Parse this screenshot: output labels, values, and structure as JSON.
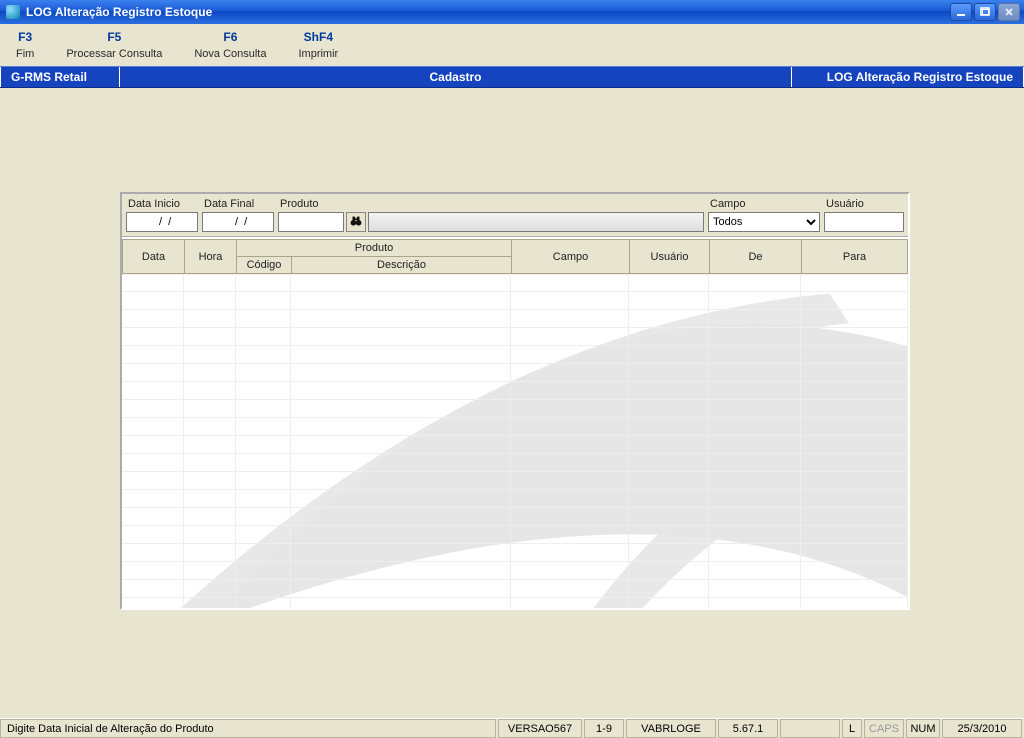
{
  "window": {
    "title": "LOG Alteração Registro Estoque"
  },
  "fnkeys": [
    {
      "key": "F3",
      "label": "Fim"
    },
    {
      "key": "F5",
      "label": "Processar Consulta"
    },
    {
      "key": "F6",
      "label": "Nova Consulta"
    },
    {
      "key": "ShF4",
      "label": "Imprimir"
    }
  ],
  "bluebar": {
    "left": "G-RMS Retail",
    "mid": "Cadastro",
    "right": "LOG Alteração Registro Estoque"
  },
  "filters": {
    "data_inicio_label": "Data Inicio",
    "data_inicio_value": "  /  /",
    "data_final_label": "Data Final",
    "data_final_value": "  /  /",
    "produto_label": "Produto",
    "produto_value": "",
    "produto_desc": "",
    "campo_label": "Campo",
    "campo_value": "Todos",
    "campo_options": [
      "Todos"
    ],
    "usuario_label": "Usuário",
    "usuario_value": ""
  },
  "grid": {
    "headers": {
      "data": "Data",
      "hora": "Hora",
      "produto": "Produto",
      "codigo": "Código",
      "descricao": "Descrição",
      "campo": "Campo",
      "usuario": "Usuário",
      "de": "De",
      "para": "Para"
    },
    "rows": []
  },
  "statusbar": {
    "hint": "Digite Data Inicial de Alteração do Produto",
    "versao": "VERSAO567",
    "range": "1-9",
    "module": "VABRLOGE",
    "version": "5.67.1",
    "mode": "L",
    "caps": "CAPS",
    "num": "NUM",
    "date": "25/3/2010"
  }
}
